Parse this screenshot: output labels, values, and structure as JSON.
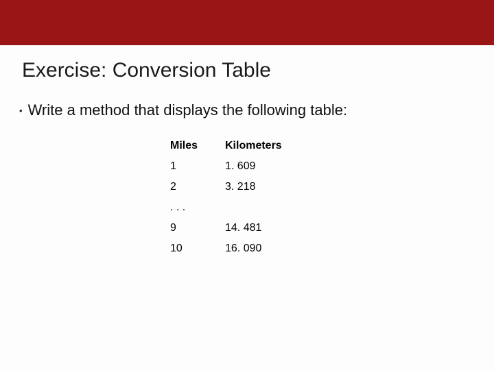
{
  "title": "Exercise: Conversion Table",
  "bullet": "Write a method that displays the following table:",
  "chart_data": {
    "type": "table",
    "columns": [
      "Miles",
      "Kilometers"
    ],
    "rows": [
      {
        "miles": "1",
        "km": "1. 609"
      },
      {
        "miles": "2",
        "km": "3. 218"
      },
      {
        "miles": ". . .",
        "km": ""
      },
      {
        "miles": "9",
        "km": "14. 481"
      },
      {
        "miles": "10",
        "km": "16. 090"
      }
    ]
  }
}
